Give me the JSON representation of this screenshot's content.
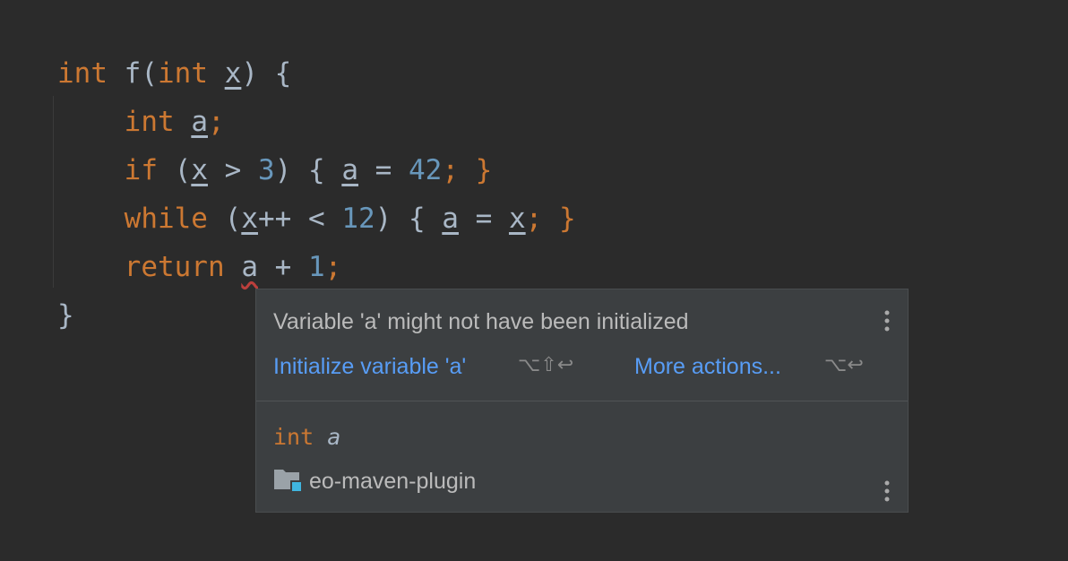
{
  "code": {
    "line1": {
      "kw": "int",
      "fn": "f",
      "open": "(",
      "kw2": "int",
      "sp": " ",
      "param": "x",
      "close": ") {"
    },
    "line2": {
      "indent": "    ",
      "kw": "int",
      "sp": " ",
      "var": "a",
      "end": ";"
    },
    "line3": {
      "indent": "    ",
      "kw": "if",
      "p1": " (",
      "v1": "x",
      "op": " > ",
      "num": "3",
      "p2": ") { ",
      "v2": "a",
      "eq": " = ",
      "num2": "42",
      "end": "; }"
    },
    "line4": {
      "indent": "    ",
      "kw": "while",
      "p1": " (",
      "v1": "x",
      "op": "++ < ",
      "num": "12",
      "p2": ") { ",
      "v2": "a",
      "eq": " = ",
      "v3": "x",
      "end": "; }"
    },
    "line5": {
      "indent": "    ",
      "kw": "return",
      "sp": " ",
      "v1": "a",
      "op": " + ",
      "num": "1",
      "end": ";"
    },
    "line6": {
      "brace": "}"
    }
  },
  "popup": {
    "message": "Variable 'a' might not have been initialized",
    "fix_label": "Initialize variable 'a'",
    "fix_shortcut": "⌥⇧↩",
    "more_label": "More actions...",
    "more_shortcut": "⌥↩",
    "decl_type": "int",
    "decl_name": "a",
    "module_icon": "folder-module-icon",
    "module_name": "eo-maven-plugin"
  },
  "colors": {
    "background": "#2b2b2b",
    "keyword": "#cc7832",
    "number": "#6897bb",
    "link": "#589df6",
    "popup_bg": "#3c3f41"
  }
}
